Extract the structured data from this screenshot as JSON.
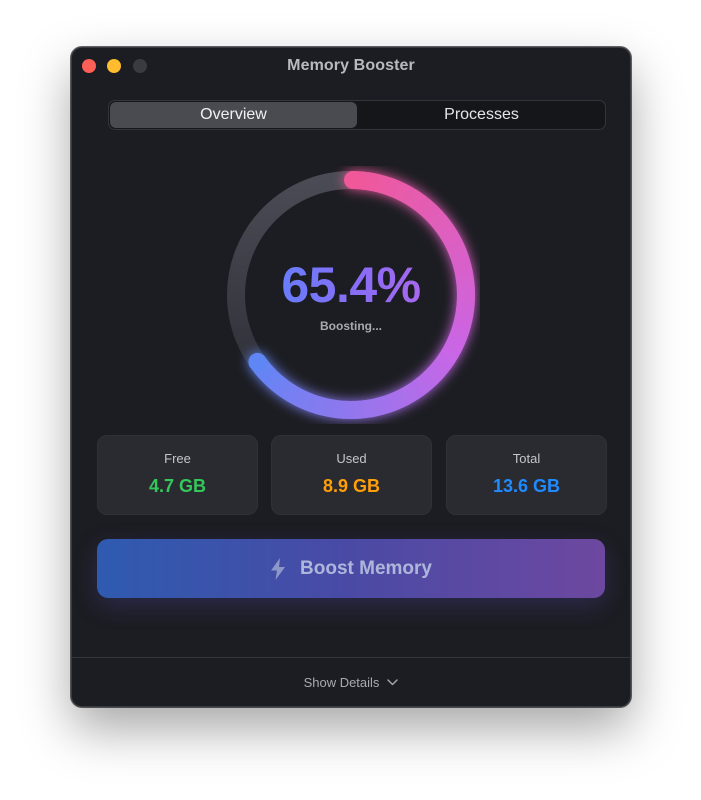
{
  "window": {
    "title": "Memory Booster"
  },
  "tabs": [
    {
      "label": "Overview",
      "active": true
    },
    {
      "label": "Processes",
      "active": false
    }
  ],
  "gauge": {
    "percent_label": "65.4%",
    "progress": 0.654,
    "status": "Boosting..."
  },
  "stats": [
    {
      "label": "Free",
      "value": "4.7 GB",
      "color": "#34c759"
    },
    {
      "label": "Used",
      "value": "8.9 GB",
      "color": "#ff9f0a"
    },
    {
      "label": "Total",
      "value": "13.6 GB",
      "color": "#1f8bff"
    }
  ],
  "boost_button": {
    "label": "Boost Memory",
    "icon": "bolt-icon"
  },
  "footer": {
    "label": "Show Details",
    "icon": "chevron-down-icon"
  },
  "colors": {
    "window_bg": "#1c1d22",
    "ring_start": "#f0589a",
    "ring_mid": "#c966e6",
    "ring_end": "#5f86f5",
    "track": "#3b3c44"
  }
}
